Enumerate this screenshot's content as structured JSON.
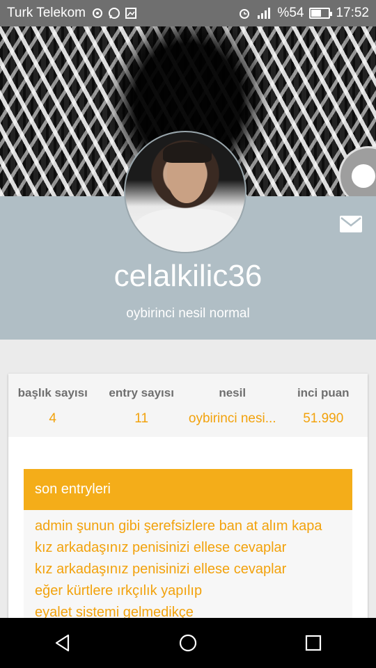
{
  "status_bar": {
    "carrier": "Turk Telekom",
    "battery": "%54",
    "battery_level": 0.54,
    "time": "17:52",
    "icons": [
      "location-ring-icon",
      "whatsapp-icon",
      "image-icon",
      "alarm-icon",
      "signal-h-icon"
    ]
  },
  "profile": {
    "username": "celalkilic36",
    "nesil_label": "oybirinci nesil normal"
  },
  "stats": [
    {
      "label": "başlık sayısı",
      "value": "4"
    },
    {
      "label": "entry sayısı",
      "value": "11"
    },
    {
      "label": "nesil",
      "value": "oybirinci nesi..."
    },
    {
      "label": "inci puan",
      "value": "51.990"
    }
  ],
  "entries": {
    "header": "son entryleri",
    "items": [
      "admin şunun gibi şerefsizlere ban at alım kapa",
      "kız arkadaşınız penisinizi ellese cevaplar",
      "kız arkadaşınız penisinizi ellese cevaplar",
      "eğer kürtlere ırkçılık yapılıp",
      "eyalet sistemi gelmedikçe"
    ]
  },
  "colors": {
    "accent": "#f4ad19",
    "profile_bg": "#b0bec5",
    "value_text": "#f2a20c"
  }
}
